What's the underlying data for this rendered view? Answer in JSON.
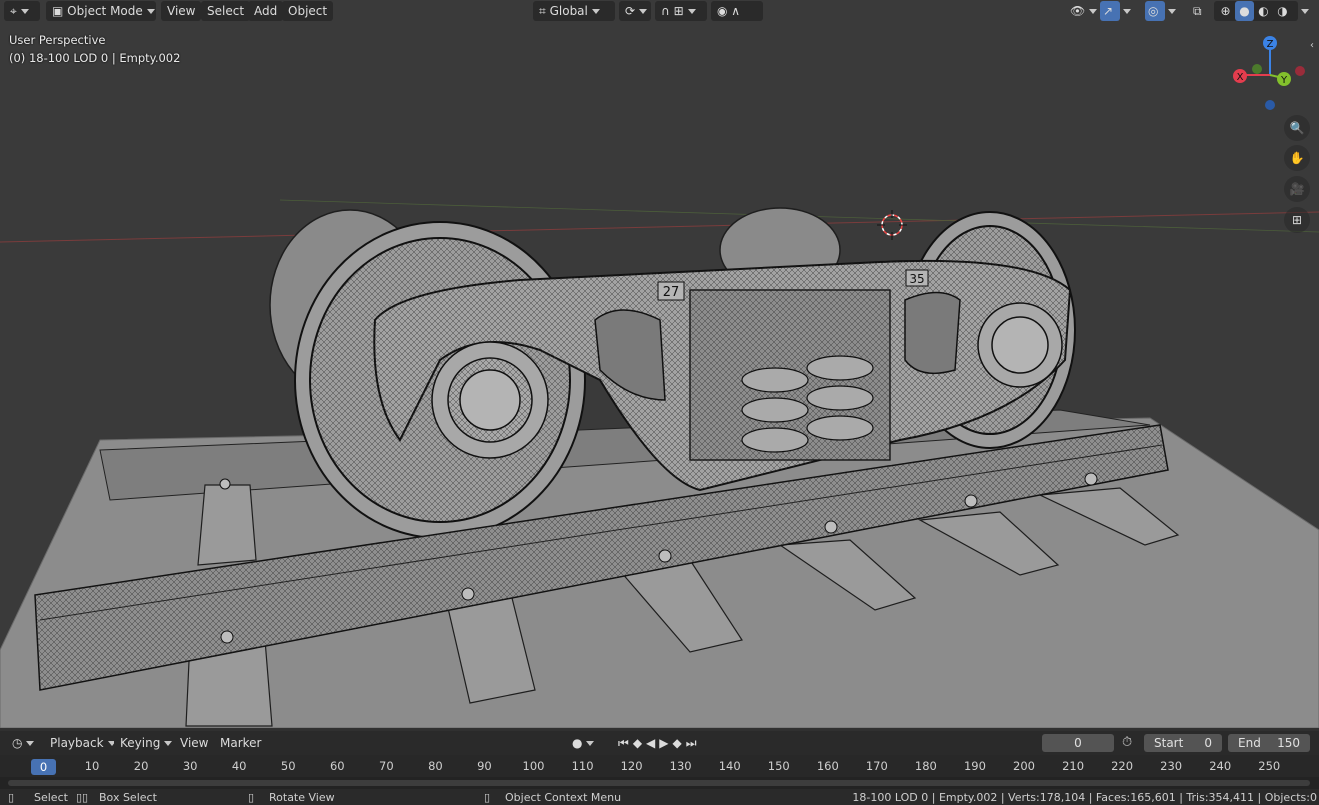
{
  "header": {
    "mode": "Object Mode",
    "menus": [
      "View",
      "Select",
      "Add",
      "Object"
    ],
    "transform_orientation": "Global"
  },
  "viewport": {
    "perspective_label": "User Perspective",
    "object_info": "(0) 18-100 LOD 0 | Empty.002",
    "gizmo": {
      "z": "Z",
      "x": "X",
      "y": "Y"
    },
    "plate_labels": [
      "27",
      "35"
    ]
  },
  "timeline": {
    "menus": [
      "Playback",
      "Keying",
      "View",
      "Marker"
    ],
    "current_frame": "0",
    "start_label": "Start",
    "start_value": "0",
    "end_label": "End",
    "end_value": "150",
    "cursor_frame": "0",
    "ticks": [
      "10",
      "20",
      "30",
      "40",
      "50",
      "60",
      "70",
      "80",
      "90",
      "100",
      "110",
      "120",
      "130",
      "140",
      "150",
      "160",
      "170",
      "180",
      "190",
      "200",
      "210",
      "220",
      "230",
      "240",
      "250"
    ]
  },
  "statusbar": {
    "select": "Select",
    "box_select": "Box Select",
    "rotate_view": "Rotate View",
    "context_menu": "Object Context Menu",
    "stats": "18-100 LOD 0 | Empty.002 | Verts:178,104 | Faces:165,601 | Tris:354,411 | Objects:0"
  },
  "colors": {
    "accent": "#4772b3",
    "x_axis": "#e33d4e",
    "y_axis": "#83c02c",
    "z_axis": "#3b83e6"
  }
}
